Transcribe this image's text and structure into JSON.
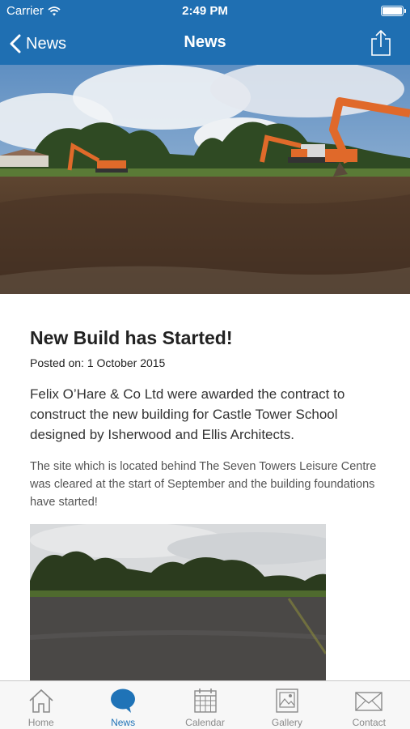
{
  "status_bar": {
    "carrier": "Carrier",
    "time": "2:49 PM"
  },
  "nav": {
    "back_label": "News",
    "title": "News"
  },
  "article": {
    "title": "New Build has Started!",
    "posted": "Posted on: 1 October 2015",
    "lead": "Felix O’Hare & Co Ltd were awarded the contract to construct the new building for Castle Tower School designed by Isherwood and Ellis Architects.",
    "body": "The site which is located behind The Seven Towers Leisure Centre was cleared at the start of September and the building foundations have started!"
  },
  "tabs": [
    {
      "label": "Home",
      "icon": "home-icon",
      "active": false
    },
    {
      "label": "News",
      "icon": "news-bubble-icon",
      "active": true
    },
    {
      "label": "Calendar",
      "icon": "calendar-icon",
      "active": false
    },
    {
      "label": "Gallery",
      "icon": "gallery-icon",
      "active": false
    },
    {
      "label": "Contact",
      "icon": "envelope-icon",
      "active": false
    }
  ],
  "colors": {
    "bar": "#1f6fb2",
    "tab_active": "#1f73b7",
    "tab_inactive": "#8a8a8a"
  }
}
